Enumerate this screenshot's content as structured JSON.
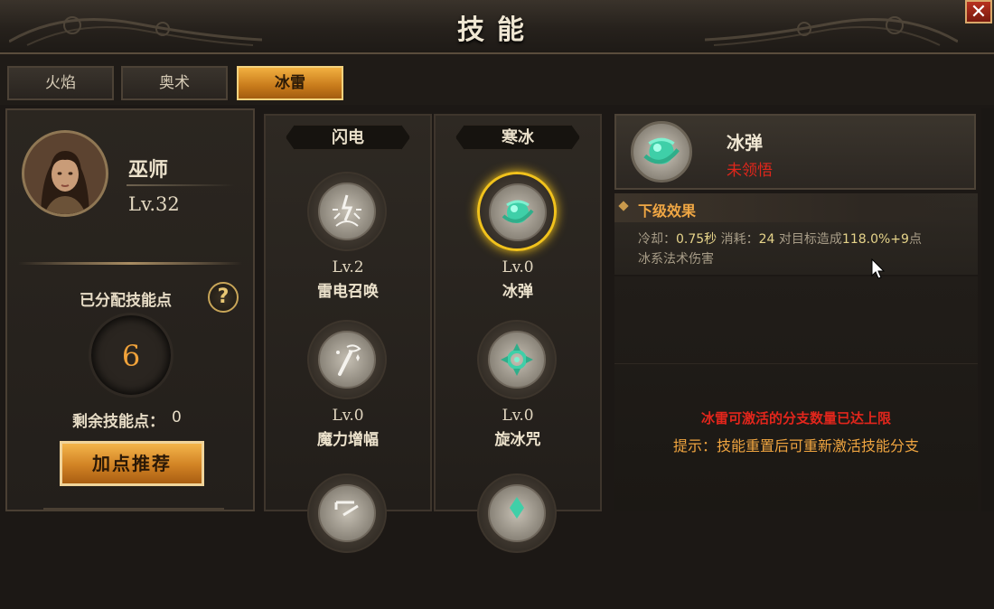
{
  "window": {
    "title": "技能",
    "close_label": "✕"
  },
  "tabs": [
    {
      "label": "火焰",
      "active": false
    },
    {
      "label": "奥术",
      "active": false
    },
    {
      "label": "冰雷",
      "active": true
    }
  ],
  "hero": {
    "name": "巫师",
    "level": "Lv.32",
    "allocated_label": "已分配技能点",
    "allocated_value": "6",
    "remaining_label": "剩余技能点：",
    "remaining_value": "0",
    "recommend_label": "加点推荐",
    "help_label": "?"
  },
  "columns": [
    {
      "header": "闪电",
      "skills": [
        {
          "level": "Lv.2",
          "name": "雷电召唤",
          "icon": "lightning-burst-icon",
          "selected": false
        },
        {
          "level": "Lv.0",
          "name": "魔力增幅",
          "icon": "wand-spark-icon",
          "selected": false
        }
      ]
    },
    {
      "header": "寒冰",
      "skills": [
        {
          "level": "Lv.0",
          "name": "冰弹",
          "icon": "ice-orb-icon",
          "selected": true
        },
        {
          "level": "Lv.0",
          "name": "旋冰咒",
          "icon": "ice-vortex-icon",
          "selected": false
        }
      ]
    }
  ],
  "detail": {
    "name": "冰弹",
    "status": "未领悟",
    "effect_title": "下级效果",
    "cooldown_label": "冷却：",
    "cooldown_value": "0.75秒",
    "cost_label": "消耗：",
    "cost_value": "24",
    "effect_text_prefix": "对目标造成",
    "effect_value": "118.0%+9",
    "effect_text_suffix": "点",
    "effect_line2": "冰系法术伤害",
    "warning": "冰雷可激活的分支数量已达上限",
    "tip": "提示：技能重置后可重新激活技能分支"
  },
  "colors": {
    "accent_orange": "#f0a540",
    "warning_red": "#e2261c",
    "selected_ring": "#f1c21c",
    "ice_teal": "#3fcfa8"
  }
}
